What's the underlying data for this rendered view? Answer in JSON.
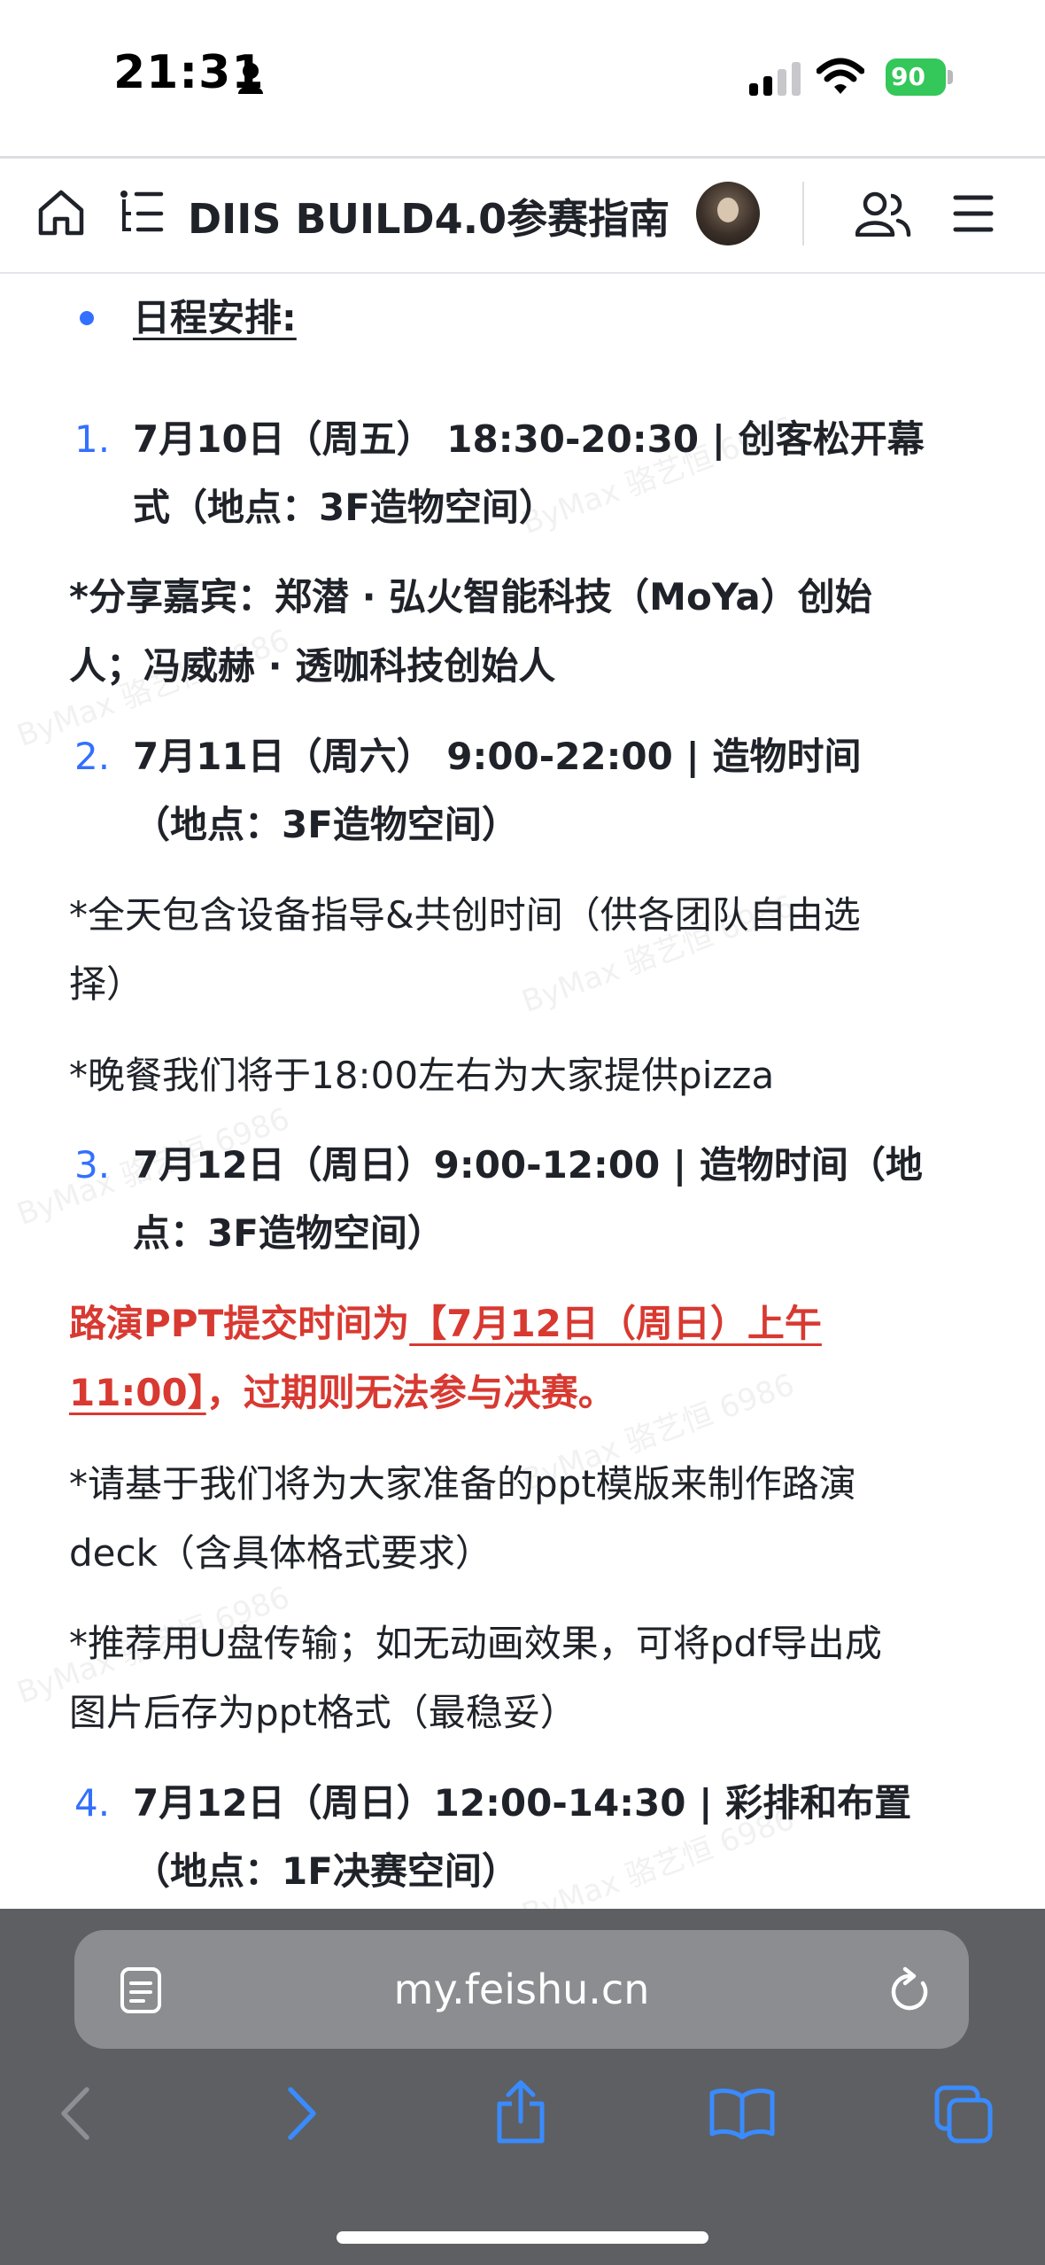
{
  "status_bar": {
    "time": "21:31",
    "battery": "90"
  },
  "header": {
    "title": "DIIS BUILD4.0参赛指南",
    "icons": [
      "home-icon",
      "outline-icon",
      "avatar",
      "collaborators-icon",
      "menu-icon"
    ]
  },
  "content": {
    "schedule_heading": "日程安排:",
    "items": [
      {
        "number": "1.",
        "line1": "7月10日（周五） 18:30-20:30 | 创客松开幕",
        "line2": "式（地点：3F造物空间）"
      },
      {
        "number": "2.",
        "line1": "7月11日（周六） 9:00-22:00 | 造物时间",
        "line2": "（地点：3F造物空间）"
      },
      {
        "number": "3.",
        "line1": "7月12日（周日）9:00-12:00 | 造物时间（地",
        "line2": "点：3F造物空间）"
      },
      {
        "number": "4.",
        "line1": "7月12日（周日）12:00-14:30 | 彩排和布置",
        "line2": "（地点：1F决赛空间）"
      }
    ],
    "guests": {
      "line1": "*分享嘉宾：郑潜 · 弘火智能科技（MoYa）创始",
      "line2": "人；冯威赫 · 透咖科技创始人"
    },
    "day2_note": {
      "line1": "*全天包含设备指导&共创时间（供各团队自由选",
      "line2": "择）"
    },
    "dinner_note": "*晚餐我们将于18:00左右为大家提供pizza",
    "deadline": {
      "prefix": "路演PPT提交时间为",
      "highlight1": "【7月12日（周日）上午",
      "highlight2": "11:00】",
      "suffix": "，过期则无法参与决赛。"
    },
    "template_note": {
      "line1": "*请基于我们将为大家准备的ppt模版来制作路演",
      "line2": "deck（含具体格式要求）"
    },
    "transfer_note": {
      "line1": "*推荐用U盘传输；如无动画效果，可将pdf导出成",
      "line2": "图片后存为ppt格式（最稳妥）"
    },
    "watermark": "ByMax 骆艺恒 6986"
  },
  "browser": {
    "url": "my.feishu.cn",
    "toolbar_icons": [
      "back-icon",
      "forward-icon",
      "share-icon",
      "bookmarks-icon",
      "tabs-icon"
    ]
  },
  "colors": {
    "accent_blue": "#3370ff",
    "alert_red": "#d83931",
    "text": "#1f2329",
    "safari_toolbar": "#5d5f63",
    "toolbar_icon_blue": "#3a8bfd"
  }
}
